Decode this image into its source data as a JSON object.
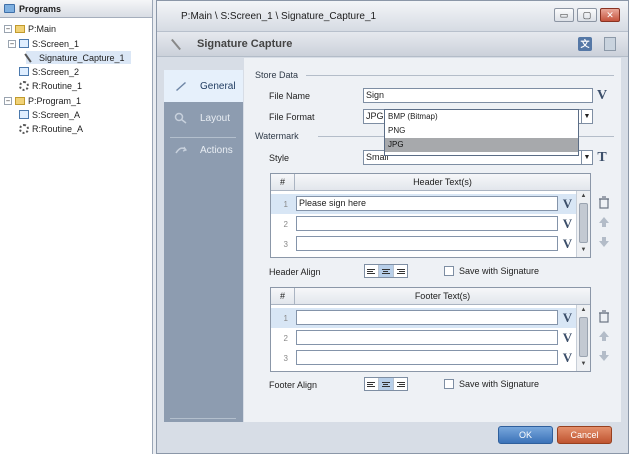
{
  "tree": {
    "title": "Programs",
    "items": [
      {
        "label": "P:Main",
        "expander": "−"
      },
      {
        "label": "S:Screen_1",
        "expander": "−"
      },
      {
        "label": "Signature_Capture_1"
      },
      {
        "label": "S:Screen_2"
      },
      {
        "label": "R:Routine_1"
      },
      {
        "label": "P:Program_1",
        "expander": "−"
      },
      {
        "label": "S:Screen_A"
      },
      {
        "label": "R:Routine_A"
      }
    ]
  },
  "window": {
    "breadcrumb": "P:Main \\ S:Screen_1 \\ Signature_Capture_1",
    "controls": {
      "minimize": "▭",
      "maximize": "▢",
      "close": "✕"
    }
  },
  "header": {
    "title": "Signature Capture",
    "translate_icon_glyph": "文"
  },
  "nav": {
    "items": [
      {
        "label": "General",
        "icon": "pen-icon"
      },
      {
        "label": "Layout",
        "icon": "layout-icon"
      },
      {
        "label": "Actions",
        "icon": "actions-icon"
      }
    ]
  },
  "store_data": {
    "section": "Store Data",
    "file_name_label": "File Name",
    "file_name_value": "Sign",
    "file_format_label": "File Format",
    "file_format_value": "JPG",
    "file_format_options": [
      "BMP (Bitmap)",
      "PNG",
      "JPG"
    ],
    "file_format_selected_index": 2
  },
  "watermark": {
    "section": "Watermark",
    "style_label": "Style",
    "style_value": "Small",
    "header_table": {
      "col_num": "#",
      "col_text": "Header Text(s)",
      "rows": [
        {
          "num": "1",
          "value": "Please sign here"
        },
        {
          "num": "2",
          "value": ""
        },
        {
          "num": "3",
          "value": ""
        }
      ]
    },
    "header_align_label": "Header Align",
    "header_save_label": "Save with Signature",
    "footer_table": {
      "col_num": "#",
      "col_text": "Footer Text(s)",
      "rows": [
        {
          "num": "1",
          "value": ""
        },
        {
          "num": "2",
          "value": ""
        },
        {
          "num": "3",
          "value": ""
        }
      ]
    },
    "footer_align_label": "Footer Align",
    "footer_save_label": "Save with Signature",
    "variable_glyph": "V",
    "text_glyph": "T",
    "dropdown_glyph": "▼"
  },
  "buttons": {
    "ok": "OK",
    "cancel": "Cancel"
  }
}
